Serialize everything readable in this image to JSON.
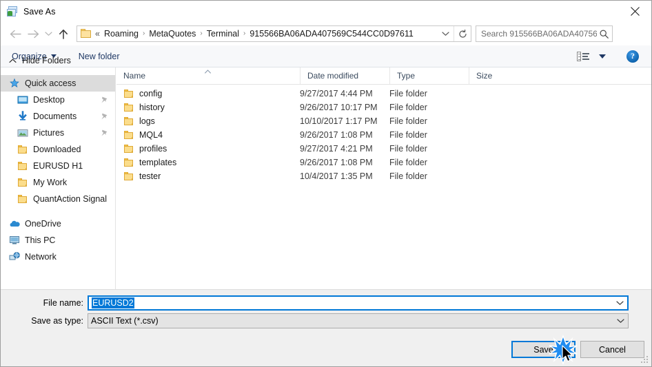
{
  "window": {
    "title": "Save As",
    "icon": "save-as-app-icon",
    "close_label": "✕"
  },
  "nav": {
    "back": "←",
    "forward": "→",
    "recent": "˅",
    "up": "↑",
    "breadcrumb_lead": "«",
    "breadcrumbs": [
      "Roaming",
      "MetaQuotes",
      "Terminal",
      "915566BA06ADA407569C544CC0D97611"
    ],
    "separator": "›",
    "dropdown_icon": "chevron-down-icon",
    "refresh_icon": "refresh-icon"
  },
  "search": {
    "placeholder": "Search 915566BA06ADA40756...",
    "icon": "search-icon"
  },
  "toolbar": {
    "organize": "Organize",
    "new_folder": "New folder",
    "view_icon": "list-view-icon",
    "help": "?"
  },
  "sidebar": {
    "items": [
      {
        "label": "Quick access",
        "icon": "star-icon",
        "level": 0,
        "selected": true,
        "pinned": false
      },
      {
        "label": "Desktop",
        "icon": "desktop-icon",
        "level": 1,
        "selected": false,
        "pinned": true
      },
      {
        "label": "Documents",
        "icon": "documents-icon",
        "level": 1,
        "selected": false,
        "pinned": true
      },
      {
        "label": "Pictures",
        "icon": "pictures-icon",
        "level": 1,
        "selected": false,
        "pinned": true
      },
      {
        "label": "Downloaded",
        "icon": "folder-icon",
        "level": 1,
        "selected": false,
        "pinned": false
      },
      {
        "label": "EURUSD H1",
        "icon": "folder-icon",
        "level": 1,
        "selected": false,
        "pinned": false
      },
      {
        "label": "My Work",
        "icon": "folder-icon",
        "level": 1,
        "selected": false,
        "pinned": false
      },
      {
        "label": "QuantAction Signal",
        "icon": "folder-icon",
        "level": 1,
        "selected": false,
        "pinned": false
      }
    ],
    "groups": [
      {
        "label": "OneDrive",
        "icon": "cloud-icon"
      },
      {
        "label": "This PC",
        "icon": "computer-icon"
      },
      {
        "label": "Network",
        "icon": "network-icon"
      }
    ]
  },
  "filelist": {
    "columns": [
      "Name",
      "Date modified",
      "Type",
      "Size"
    ],
    "sort_column": "Name",
    "sort_direction": "ascending",
    "rows": [
      {
        "name": "config",
        "date": "9/27/2017 4:44 PM",
        "type": "File folder",
        "size": ""
      },
      {
        "name": "history",
        "date": "9/26/2017 10:17 PM",
        "type": "File folder",
        "size": ""
      },
      {
        "name": "logs",
        "date": "10/10/2017 1:17 PM",
        "type": "File folder",
        "size": ""
      },
      {
        "name": "MQL4",
        "date": "9/26/2017 1:08 PM",
        "type": "File folder",
        "size": ""
      },
      {
        "name": "profiles",
        "date": "9/27/2017 4:21 PM",
        "type": "File folder",
        "size": ""
      },
      {
        "name": "templates",
        "date": "9/26/2017 1:08 PM",
        "type": "File folder",
        "size": ""
      },
      {
        "name": "tester",
        "date": "10/4/2017 1:35 PM",
        "type": "File folder",
        "size": ""
      }
    ]
  },
  "form": {
    "file_name_label": "File name:",
    "file_name_value": "EURUSD2",
    "save_as_type_label": "Save as type:",
    "save_as_type_value": "ASCII Text (*.csv)"
  },
  "footer": {
    "hide_folders": "Hide Folders",
    "save": "Save",
    "cancel": "Cancel"
  },
  "colors": {
    "accent": "#0078d7",
    "toolbar_text": "#1f3864",
    "folder": "#fbdd8c",
    "selection": "#dcdcdc"
  }
}
